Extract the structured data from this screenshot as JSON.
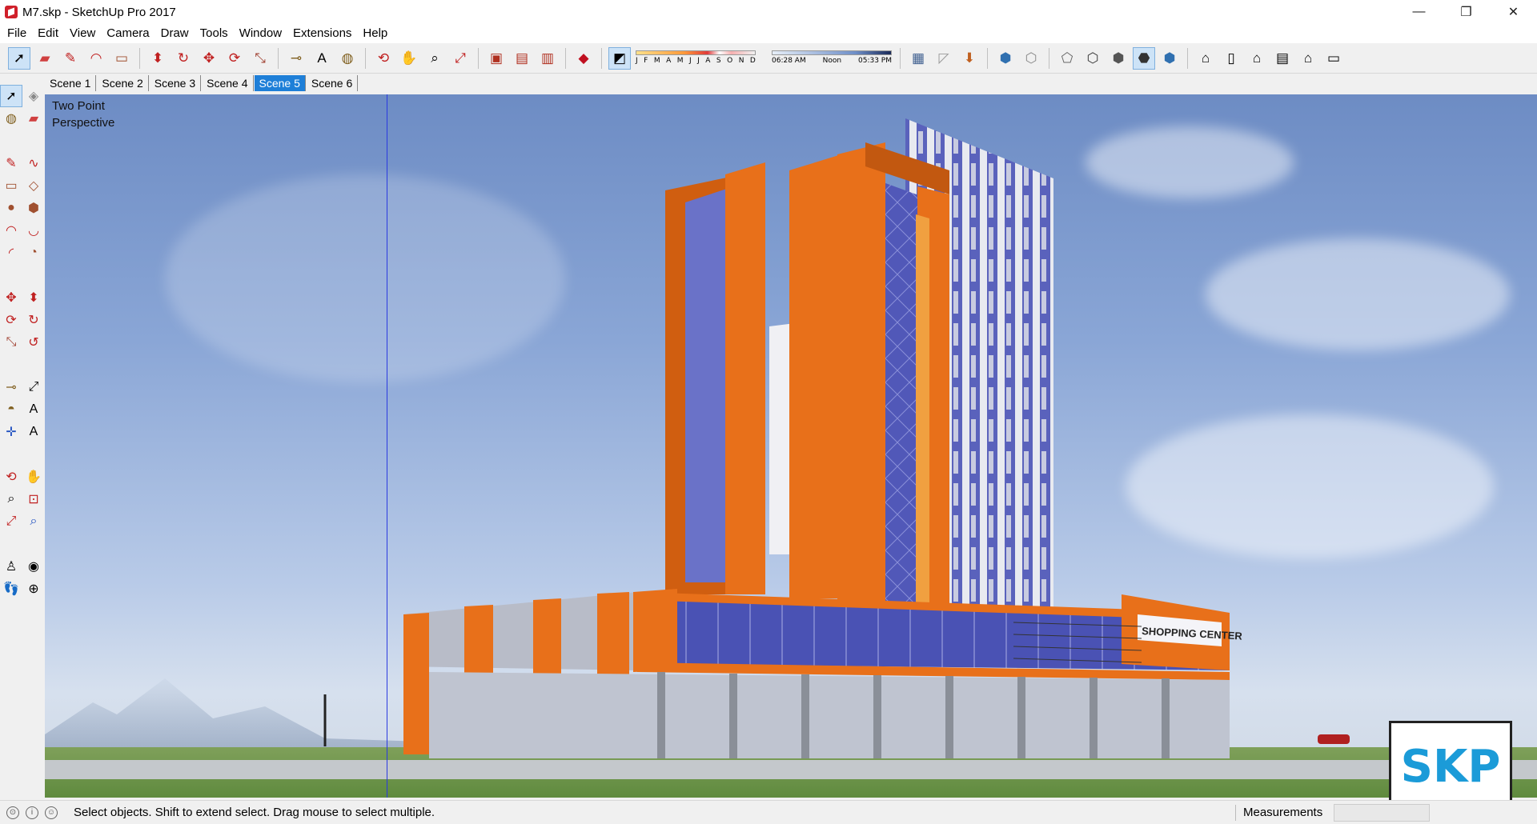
{
  "window": {
    "title": "M7.skp - SketchUp Pro 2017",
    "minimize_label": "—",
    "restore_label": "❐",
    "close_label": "✕"
  },
  "menu": [
    "File",
    "Edit",
    "View",
    "Camera",
    "Draw",
    "Tools",
    "Window",
    "Extensions",
    "Help"
  ],
  "shadow": {
    "months": [
      "J",
      "F",
      "M",
      "A",
      "M",
      "J",
      "J",
      "A",
      "S",
      "O",
      "N",
      "D"
    ],
    "time_start": "06:28 AM",
    "time_mid": "Noon",
    "time_end": "05:33 PM"
  },
  "scenes": {
    "tabs": [
      "Scene 1",
      "Scene 2",
      "Scene 3",
      "Scene 4",
      "Scene 5",
      "Scene 6"
    ],
    "active": "Scene 5"
  },
  "viewport": {
    "camera_label": "Two Point\nPerspective",
    "sign_text": "SHOPPING CENTER",
    "logo_text": "SKP"
  },
  "status": {
    "message": "Select objects. Shift to extend select. Drag mouse to select multiple.",
    "measurements_label": "Measurements",
    "measurements_value": ""
  },
  "colors": {
    "accent_orange": "#e8701a",
    "glass_blue": "#4a55b8",
    "scene_active": "#1e7fd8"
  }
}
